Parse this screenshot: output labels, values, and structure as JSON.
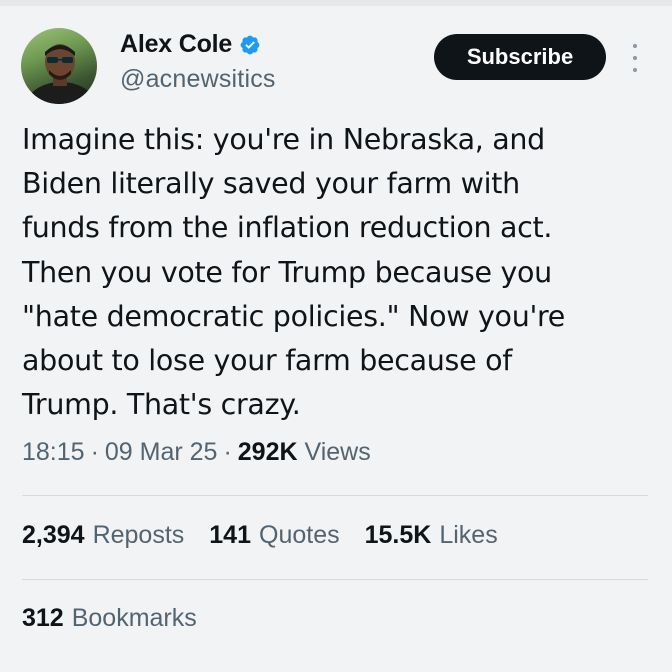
{
  "author": {
    "name": "Alex Cole",
    "handle": "@acnewsitics",
    "verified": true,
    "verified_color": "#1d9bf0"
  },
  "actions": {
    "subscribe_label": "Subscribe",
    "more_icon": "more-vertical-icon"
  },
  "tweet": {
    "lines": [
      "Imagine this: you're in Nebraska, and",
      "Biden literally saved your farm with",
      "funds from the inflation reduction act.",
      "Then you vote for Trump because you",
      "\"hate democratic policies.\" Now you're",
      "about to lose your farm because of",
      "Trump. That's crazy."
    ]
  },
  "meta": {
    "time": "18:15",
    "separator": "·",
    "date": "09 Mar 25",
    "views_count": "292K",
    "views_label": "Views"
  },
  "stats": {
    "reposts_count": "2,394",
    "reposts_label": "Reposts",
    "quotes_count": "141",
    "quotes_label": "Quotes",
    "likes_count": "15.5K",
    "likes_label": "Likes",
    "bookmarks_count": "312",
    "bookmarks_label": "Bookmarks"
  }
}
